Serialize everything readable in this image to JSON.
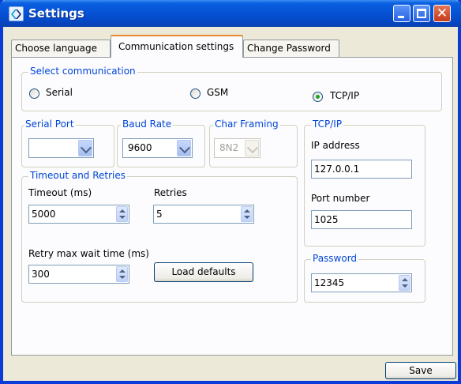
{
  "window": {
    "title": "Settings"
  },
  "tabs": [
    {
      "label": "Choose language"
    },
    {
      "label": "Communication settings"
    },
    {
      "label": "Change Password"
    }
  ],
  "select_communication": {
    "legend": "Select communication",
    "options": [
      {
        "label": "Serial",
        "checked": false
      },
      {
        "label": "GSM",
        "checked": false
      },
      {
        "label": "TCP/IP",
        "checked": true
      }
    ]
  },
  "serial_port": {
    "legend": "Serial Port",
    "value": ""
  },
  "baud_rate": {
    "legend": "Baud Rate",
    "value": "9600"
  },
  "char_framing": {
    "legend": "Char Framing",
    "value": "8N2",
    "disabled": true
  },
  "tcpip": {
    "legend": "TCP/IP",
    "ip_label": "IP address",
    "ip_value": "127.0.0.1",
    "port_label": "Port number",
    "port_value": "1025"
  },
  "timeout_retries": {
    "legend": "Timeout and Retries",
    "timeout_label": "Timeout (ms)",
    "timeout_value": "5000",
    "retries_label": "Retries",
    "retries_value": "5",
    "max_wait_label": "Retry max wait time (ms)",
    "max_wait_value": "300",
    "load_defaults_label": "Load defaults"
  },
  "password": {
    "legend": "Password",
    "value": "12345"
  },
  "footer": {
    "save_label": "Save"
  },
  "colors": {
    "titlebar": "#0653d6",
    "legend_text": "#0046d5",
    "tab_highlight": "#e68b2c",
    "radio_dot": "#21a121"
  }
}
